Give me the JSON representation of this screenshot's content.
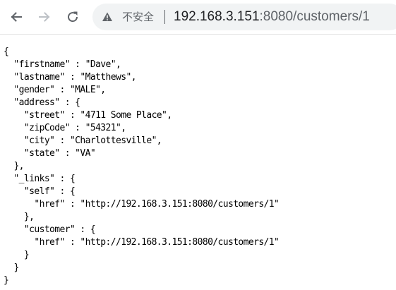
{
  "browser": {
    "security_label": "不安全",
    "url_host": "192.168.3.151",
    "url_rest": ":8080/customers/1",
    "icons": {
      "back": "arrow-left-icon",
      "forward": "arrow-right-icon",
      "reload": "reload-icon",
      "security": "warning-triangle-icon"
    }
  },
  "json_lines": [
    "{",
    "  \"firstname\" : \"Dave\",",
    "  \"lastname\" : \"Matthews\",",
    "  \"gender\" : \"MALE\",",
    "  \"address\" : {",
    "    \"street\" : \"4711 Some Place\",",
    "    \"zipCode\" : \"54321\",",
    "    \"city\" : \"Charlottesville\",",
    "    \"state\" : \"VA\"",
    "  },",
    "  \"_links\" : {",
    "    \"self\" : {",
    "      \"href\" : \"http://192.168.3.151:8080/customers/1\"",
    "    },",
    "    \"customer\" : {",
    "      \"href\" : \"http://192.168.3.151:8080/customers/1\"",
    "    }",
    "  }",
    "}"
  ]
}
